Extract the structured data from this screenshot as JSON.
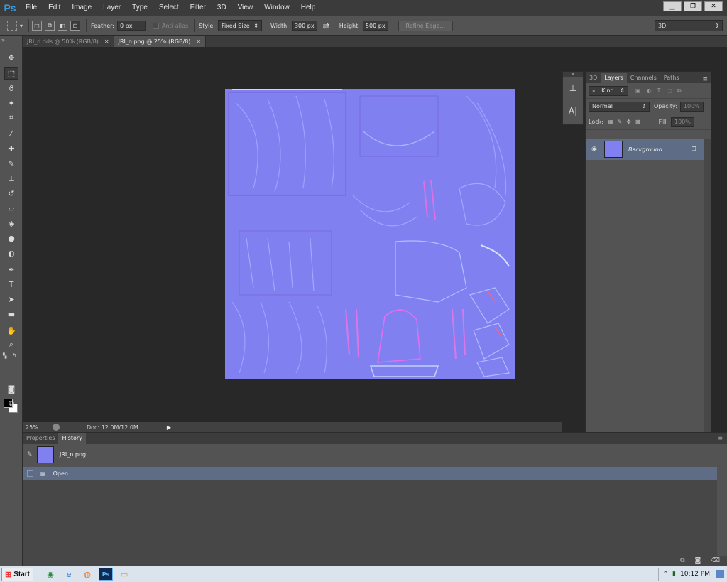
{
  "app": {
    "logo": "Ps"
  },
  "menu": [
    "File",
    "Edit",
    "Image",
    "Layer",
    "Type",
    "Select",
    "Filter",
    "3D",
    "View",
    "Window",
    "Help"
  ],
  "window_controls": {
    "minimize": "▁",
    "restore": "❐",
    "close": "✕"
  },
  "options": {
    "feather_label": "Feather:",
    "feather_value": "0 px",
    "antialias_label": "Anti-alias",
    "style_label": "Style:",
    "style_value": "Fixed Size",
    "width_label": "Width:",
    "width_value": "300 px",
    "height_label": "Height:",
    "height_value": "500 px",
    "refine_edge": "Refine Edge...",
    "workspace": "3D"
  },
  "tabs": [
    {
      "label": "JRI_d.dds @ 50% (RGB/8)",
      "active": false
    },
    {
      "label": "JRI_n.png @ 25% (RGB/8)",
      "active": true
    }
  ],
  "status": {
    "zoom": "25%",
    "doc": "Doc: 12.0M/12.0M"
  },
  "layers_panel": {
    "tabs": [
      "3D",
      "Layers",
      "Channels",
      "Paths"
    ],
    "filter_label": "Kind",
    "blend_mode": "Normal",
    "opacity_label": "Opacity:",
    "opacity_value": "100%",
    "lock_label": "Lock:",
    "fill_label": "Fill:",
    "fill_value": "100%",
    "layer_name": "Background"
  },
  "history_panel": {
    "tabs": [
      "Properties",
      "History"
    ],
    "snapshot_name": "JRI_n.png",
    "state_name": "Open"
  },
  "taskbar": {
    "start_label": "Start",
    "clock": "10:12 PM"
  },
  "colors": {
    "normal_map_base": "#8080f0",
    "panel": "#535353",
    "selection": "#5e6d85",
    "ps_blue": "#3a9bdf"
  }
}
